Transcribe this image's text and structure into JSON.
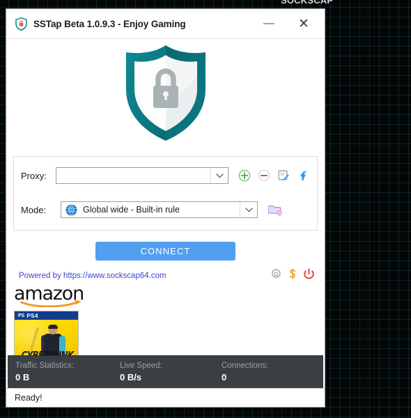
{
  "desktop": {
    "clipped_top_text": "SOCKSCAP"
  },
  "window": {
    "title": "SSTap Beta 1.0.9.3 - Enjoy Gaming",
    "app_icon": "shield-lock-icon",
    "minimize_label": "—",
    "close_label": "✕"
  },
  "logo": {
    "icon": "shield-lock-logo",
    "shield_color": "#0e7b85",
    "lock_color": "#aab3b5"
  },
  "settings": {
    "proxy": {
      "label": "Proxy:",
      "value": "",
      "placeholder": "",
      "actions": [
        {
          "name": "add-proxy-button",
          "icon": "plus-circle-icon",
          "color": "#5cb85c"
        },
        {
          "name": "remove-proxy-button",
          "icon": "minus-circle-icon",
          "color": "#e8453c"
        },
        {
          "name": "edit-proxy-button",
          "icon": "edit-note-icon",
          "color": "#3d9be9"
        },
        {
          "name": "speed-test-button",
          "icon": "lightning-bolt-icon",
          "color": "#1e90ff"
        }
      ]
    },
    "mode": {
      "label": "Mode:",
      "value": "Global wide - Built-in rule",
      "icon": "globe-icon",
      "actions": [
        {
          "name": "rules-folder-button",
          "icon": "folder-settings-icon",
          "color": "#c9a8f0"
        }
      ]
    }
  },
  "connect": {
    "label": "CONNECT",
    "color": "#529ff0"
  },
  "powered": {
    "text": "Powered by https://www.sockscap64.com",
    "color": "#3f44d6",
    "icons": [
      {
        "name": "settings-gear-icon",
        "color": "#9e9e9e"
      },
      {
        "name": "donate-dollar-icon",
        "color": "#f0a030"
      },
      {
        "name": "power-off-icon",
        "color": "#e8453c"
      }
    ]
  },
  "ad": {
    "brand": "amazon",
    "product": {
      "platform_logo": "PS",
      "platform": "PS4",
      "title": "CYBERPUNK"
    }
  },
  "stats": {
    "traffic": {
      "label": "Traffic Statistics:",
      "value": "0 B"
    },
    "speed": {
      "label": "Live Speed:",
      "value": "0 B/s"
    },
    "connections": {
      "label": "Connections:",
      "value": "0"
    }
  },
  "status": {
    "text": "Ready!"
  }
}
